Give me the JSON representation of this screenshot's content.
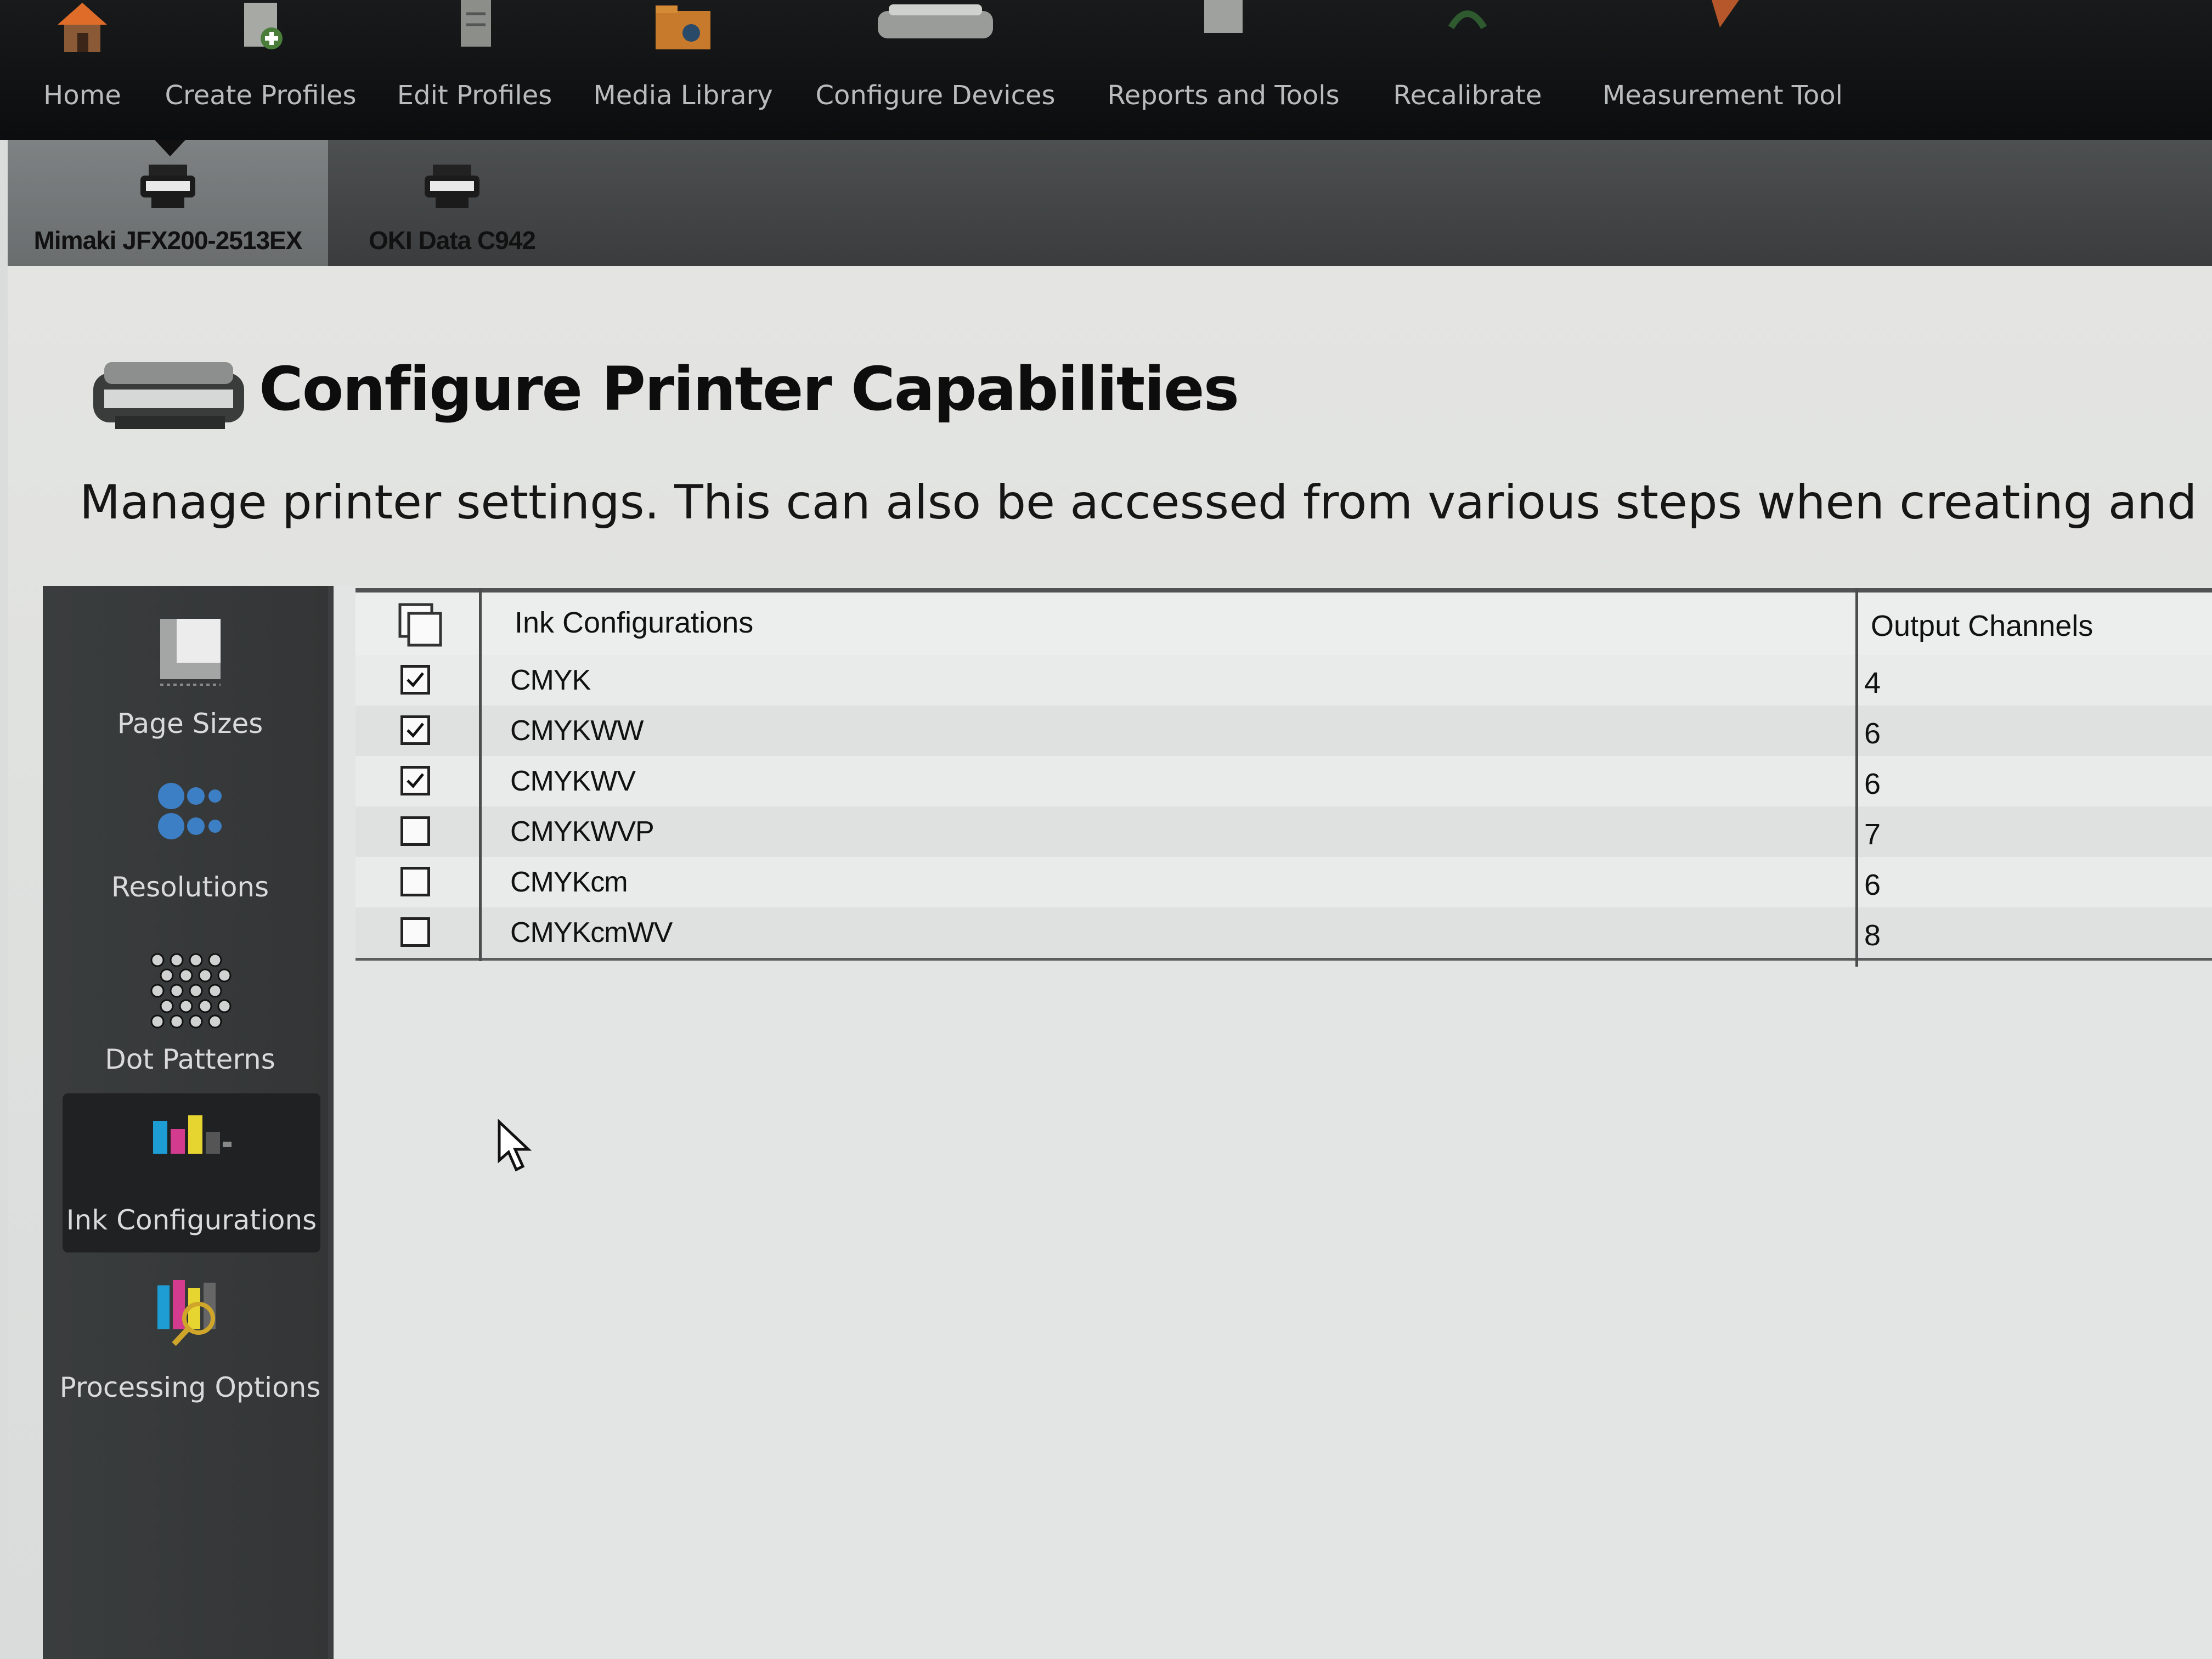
{
  "top_nav": {
    "items": [
      {
        "label": "Home",
        "icon": "house-icon"
      },
      {
        "label": "Create Profiles",
        "icon": "create-profile-icon"
      },
      {
        "label": "Edit Profiles",
        "icon": "edit-profile-icon"
      },
      {
        "label": "Media Library",
        "icon": "media-library-icon"
      },
      {
        "label": "Configure Devices",
        "icon": "printer-icon"
      },
      {
        "label": "Reports and Tools",
        "icon": "reports-icon"
      },
      {
        "label": "Recalibrate",
        "icon": "recalibrate-icon"
      },
      {
        "label": "Measurement Tool",
        "icon": "measurement-icon"
      }
    ]
  },
  "devices": [
    {
      "label": "Mimaki JFX200-2513EX",
      "selected": true
    },
    {
      "label": "OKI Data C942",
      "selected": false
    }
  ],
  "page": {
    "title": "Configure Printer Capabilities",
    "description": "Manage printer settings.  This can also be accessed from various steps when creating and editin"
  },
  "side_menu": {
    "items": [
      {
        "label": "Page Sizes",
        "icon": "page-sizes-icon",
        "active": false
      },
      {
        "label": "Resolutions",
        "icon": "resolutions-icon",
        "active": false
      },
      {
        "label": "Dot Patterns",
        "icon": "dot-patterns-icon",
        "active": false
      },
      {
        "label": "Ink Configurations",
        "icon": "ink-configurations-icon",
        "active": true
      },
      {
        "label": "Processing Options",
        "icon": "processing-options-icon",
        "active": false
      }
    ]
  },
  "table": {
    "headers": {
      "ink": "Ink Configurations",
      "channels": "Output Channels"
    },
    "rows": [
      {
        "name": "CMYK",
        "channels": "4",
        "checked": true
      },
      {
        "name": "CMYKWW",
        "channels": "6",
        "checked": true
      },
      {
        "name": "CMYKWV",
        "channels": "6",
        "checked": true
      },
      {
        "name": "CMYKWVP",
        "channels": "7",
        "checked": false
      },
      {
        "name": "CMYKcm",
        "channels": "6",
        "checked": false
      },
      {
        "name": "CMYKcmWV",
        "channels": "8",
        "checked": false
      }
    ]
  }
}
